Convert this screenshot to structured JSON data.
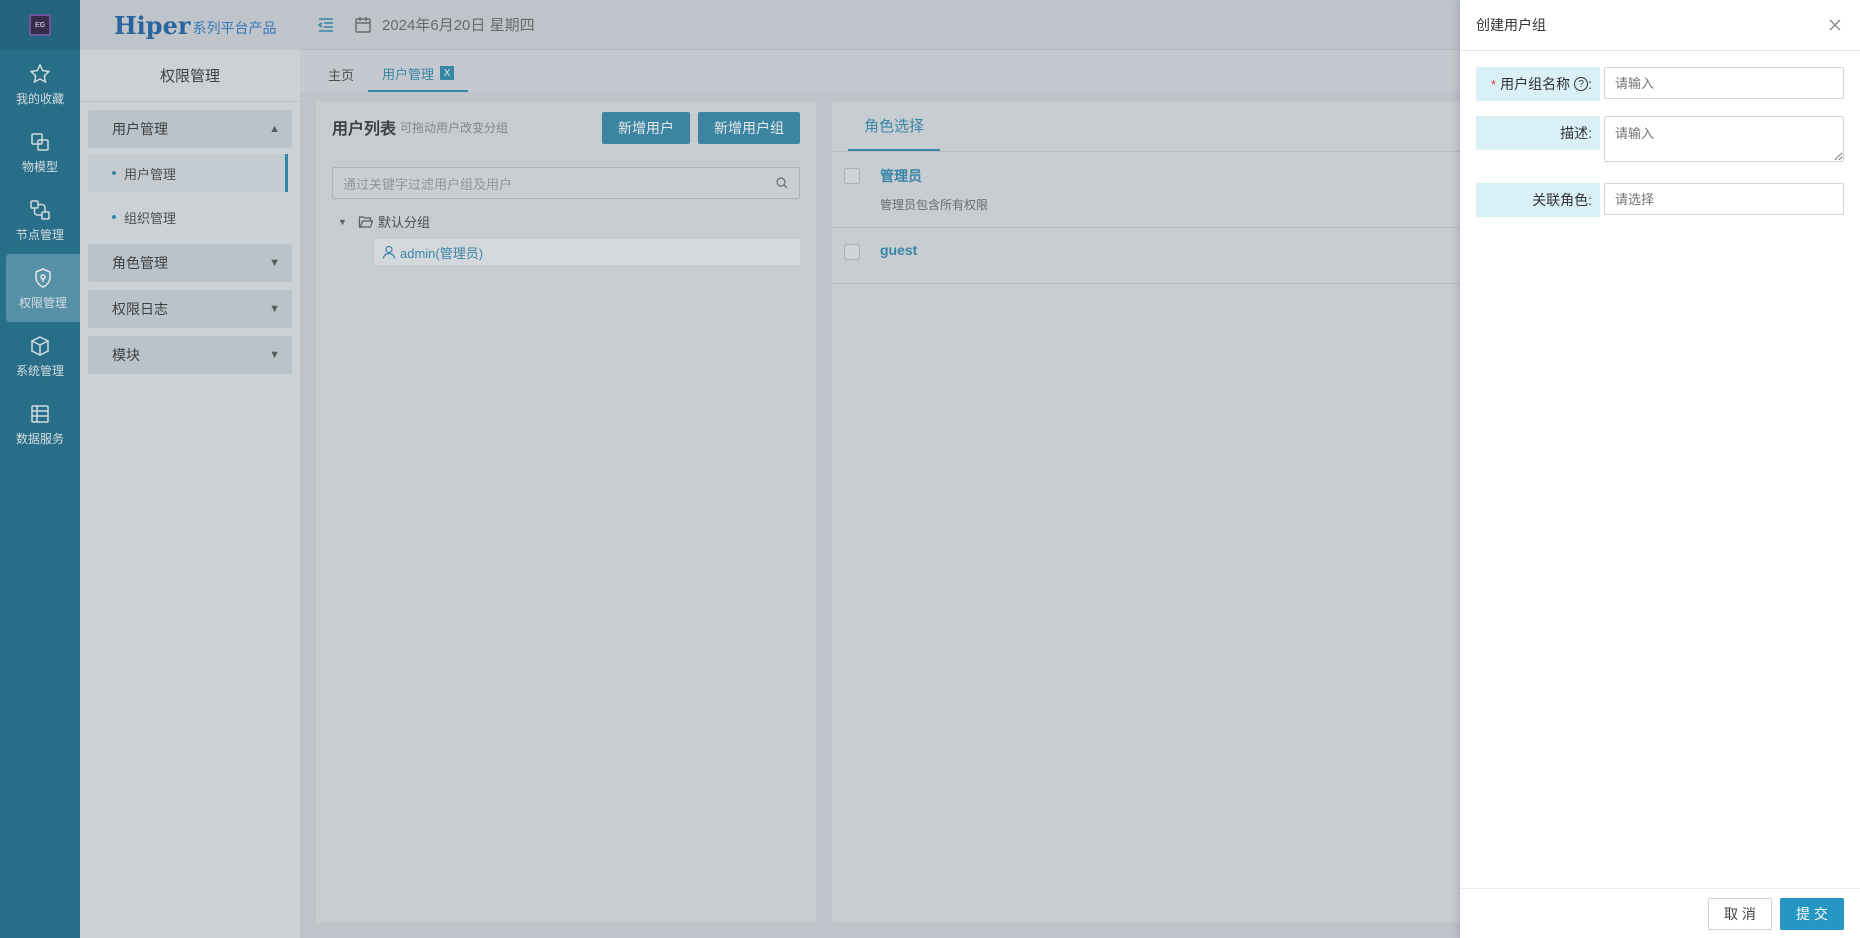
{
  "brand": {
    "name": "Hiper",
    "suffix": "系列平台产品"
  },
  "rail": {
    "items": [
      {
        "label": "我的收藏",
        "icon": "star-icon"
      },
      {
        "label": "物模型",
        "icon": "model-icon"
      },
      {
        "label": "节点管理",
        "icon": "node-icon"
      },
      {
        "label": "权限管理",
        "icon": "shield-icon"
      },
      {
        "label": "系统管理",
        "icon": "box-icon"
      },
      {
        "label": "数据服务",
        "icon": "data-icon"
      }
    ],
    "active": "权限管理"
  },
  "sidebar": {
    "title": "权限管理",
    "groups": [
      {
        "label": "用户管理",
        "expanded": true,
        "children": [
          "用户管理",
          "组织管理"
        ]
      },
      {
        "label": "角色管理",
        "expanded": false
      },
      {
        "label": "权限日志",
        "expanded": false
      },
      {
        "label": "模块",
        "expanded": false
      }
    ],
    "active_child": "用户管理"
  },
  "topbar": {
    "date": "2024年6月20日 星期四"
  },
  "tabs": [
    {
      "label": "主页",
      "active": false
    },
    {
      "label": "用户管理",
      "active": true,
      "close": "X"
    }
  ],
  "user_panel": {
    "title": "用户列表",
    "hint": "可拖动用户改变分组",
    "add_user": "新增用户",
    "add_group": "新增用户组",
    "search_placeholder": "通过关键字过滤用户组及用户",
    "tree": {
      "root": "默认分组",
      "leaf": "admin(管理员)"
    }
  },
  "role_panel": {
    "tab": "角色选择",
    "roles": [
      {
        "name": "管理员",
        "desc": "管理员包含所有权限"
      },
      {
        "name": "guest",
        "desc": ""
      }
    ]
  },
  "drawer": {
    "title": "创建用户组",
    "fields": {
      "name_label": "用户组名称",
      "name_suffix": ":",
      "name_placeholder": "请输入",
      "desc_label": "描述:",
      "desc_placeholder": "请输入",
      "role_label": "关联角色:",
      "role_placeholder": "请选择"
    },
    "required_mark": "*",
    "help_mark": "?",
    "cancel": "取 消",
    "submit": "提 交"
  },
  "colors": {
    "rail": "#176b88",
    "accent": "#2a88ad",
    "submit": "#2697c2",
    "label_bg": "#daf0f7",
    "required": "#e8413a"
  }
}
